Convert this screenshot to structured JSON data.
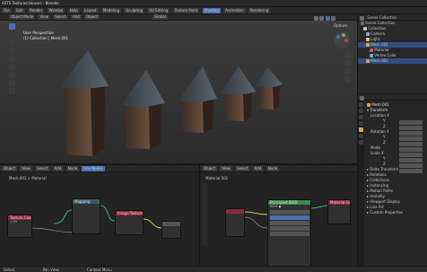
{
  "window": {
    "title": "ASTS Textured Houses - Blender"
  },
  "menubar": {
    "items": [
      "File",
      "Edit",
      "Render",
      "Window",
      "Help",
      "Layout",
      "Modeling",
      "Sculpting",
      "UV Editing",
      "Texture Paint",
      "Shading",
      "Animation",
      "Rendering"
    ]
  },
  "viewport": {
    "header_items": [
      "Object Mode",
      "View",
      "Select",
      "Add",
      "Object"
    ],
    "mode_label": "Global",
    "info_line1": "User Perspective",
    "info_line2": "(1) Collection | Mesh.001",
    "gizmo_label": "Options"
  },
  "outliner": {
    "title": "Scene Collection",
    "rows": [
      "Scene Collection",
      "Collection",
      "Camera",
      "Light",
      "Mesh.001",
      "Material",
      "Vertex Color",
      "Mesh.002"
    ]
  },
  "properties": {
    "header": "Mesh.001",
    "section_transform": "Transform",
    "labels": [
      "Location X",
      "Y",
      "Z",
      "Rotation X",
      "Y",
      "Z",
      "Mode",
      "Scale X",
      "Y",
      "Z",
      "Delta Transform",
      "Relations",
      "Collections",
      "Instancing",
      "Motion Paths",
      "Visibility",
      "Viewport Display",
      "Line Art",
      "Custom Properties"
    ]
  },
  "node_editor_left": {
    "header_items": [
      "Object",
      "View",
      "Select",
      "Add",
      "Node",
      "Use Nodes"
    ],
    "breadcrumb": "Mesh.001 > Material"
  },
  "node_editor_right": {
    "header_items": [
      "Object",
      "View",
      "Select",
      "Add",
      "Node"
    ],
    "breadcrumb": "Material.001"
  },
  "nodes": [
    {
      "title": "Texture Coordinate",
      "color": "#8b2a3d"
    },
    {
      "title": "Mapping",
      "color": "#3c5a6e"
    },
    {
      "title": "Image Texture",
      "color": "#8b2a3d"
    },
    {
      "title": "Principled BSDF",
      "color": "#3a8a4a"
    },
    {
      "title": "Material Output",
      "color": "#8b2a3d"
    }
  ],
  "statusbar": {
    "items": [
      "Select",
      "Pan View",
      "Context Menu"
    ]
  },
  "colors": {
    "accent": "#4772b3",
    "shader_green": "#3a8a4a",
    "link_green": "#3fb36e"
  }
}
